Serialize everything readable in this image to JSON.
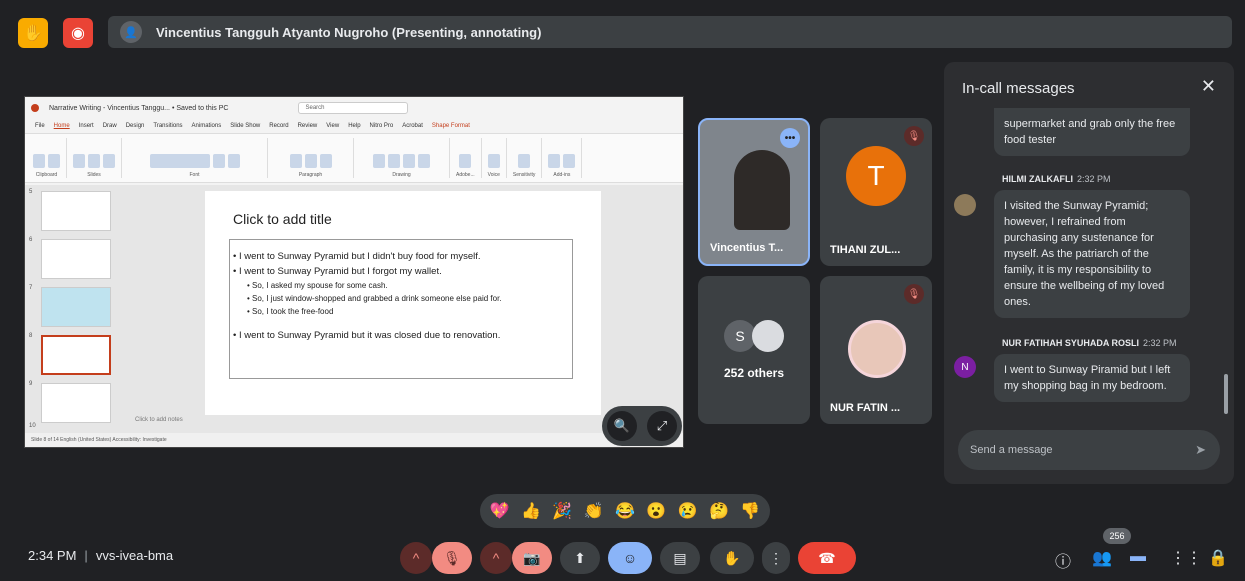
{
  "presenter": {
    "name": "Vincentius Tangguh Atyanto Nugroho (Presenting, annotating)"
  },
  "shared_screen": {
    "window_title": "Narrative Writing - Vincentius Tanggu... • Saved to this PC",
    "search_placeholder": "Search",
    "menu": [
      "File",
      "Home",
      "Insert",
      "Draw",
      "Design",
      "Transitions",
      "Animations",
      "Slide Show",
      "Record",
      "Review",
      "View",
      "Help",
      "Nitro Pro",
      "Acrobat",
      "Shape Format"
    ],
    "ribbon_groups": [
      "Clipboard",
      "Slides",
      "Font",
      "Paragraph",
      "Drawing",
      "Adobe...",
      "Voice",
      "Sensitivity",
      "Add-ins"
    ],
    "thumb_numbers": [
      "5",
      "6",
      "7",
      "8",
      "9",
      "10"
    ],
    "slide": {
      "title": "Click to add title",
      "bullet1": "• I went to Sunway Pyramid but I didn't buy food for myself.",
      "bullet2": "• I went to Sunway Pyramid but I forgot my wallet.",
      "sub1": "• So, I asked my spouse for some cash.",
      "sub2": "• So, I just window-shopped and grabbed a drink someone else paid for.",
      "sub3": "• So, I took the free-food",
      "bullet3": "• I went to Sunway Pyramid but it was closed due to renovation."
    },
    "notes": "Click to add notes",
    "status": "Slide 8 of 14    English (United States)    Accessibility: Investigate"
  },
  "tiles": {
    "vincentius": "Vincentius T...",
    "tihani": "TIHANI ZUL...",
    "tihani_initial": "T",
    "others_initial": "S",
    "others": "252 others",
    "nur": "NUR FATIN ..."
  },
  "chat": {
    "title": "In-call messages",
    "messages": [
      {
        "sender": "",
        "time": "",
        "text": "supermarket and grab only the free food tester"
      },
      {
        "sender": "HILMI ZALKAFLI",
        "time": "2:32 PM",
        "text": "I visited the Sunway Pyramid; however, I refrained from purchasing any sustenance for myself. As the patriarch of the family, it is my responsibility to ensure the wellbeing of my loved ones."
      },
      {
        "sender": "NUR FATIHAH SYUHADA ROSLI",
        "time": "2:32 PM",
        "initial": "N",
        "text": "I went to Sunway Piramid but I left my shopping bag in my bedroom."
      }
    ],
    "input_placeholder": "Send a message"
  },
  "reactions": [
    "💖",
    "👍",
    "🎉",
    "👏",
    "😂",
    "😮",
    "😢",
    "🤔",
    "👎"
  ],
  "bottom": {
    "time": "2:34 PM",
    "meeting_code": "vvs-ivea-bma",
    "participant_count": "256"
  },
  "colors": {
    "background": "#202124",
    "accent_blue": "#8ab4f8",
    "end_call_red": "#ea4335",
    "muted_red": "#f28b82"
  }
}
